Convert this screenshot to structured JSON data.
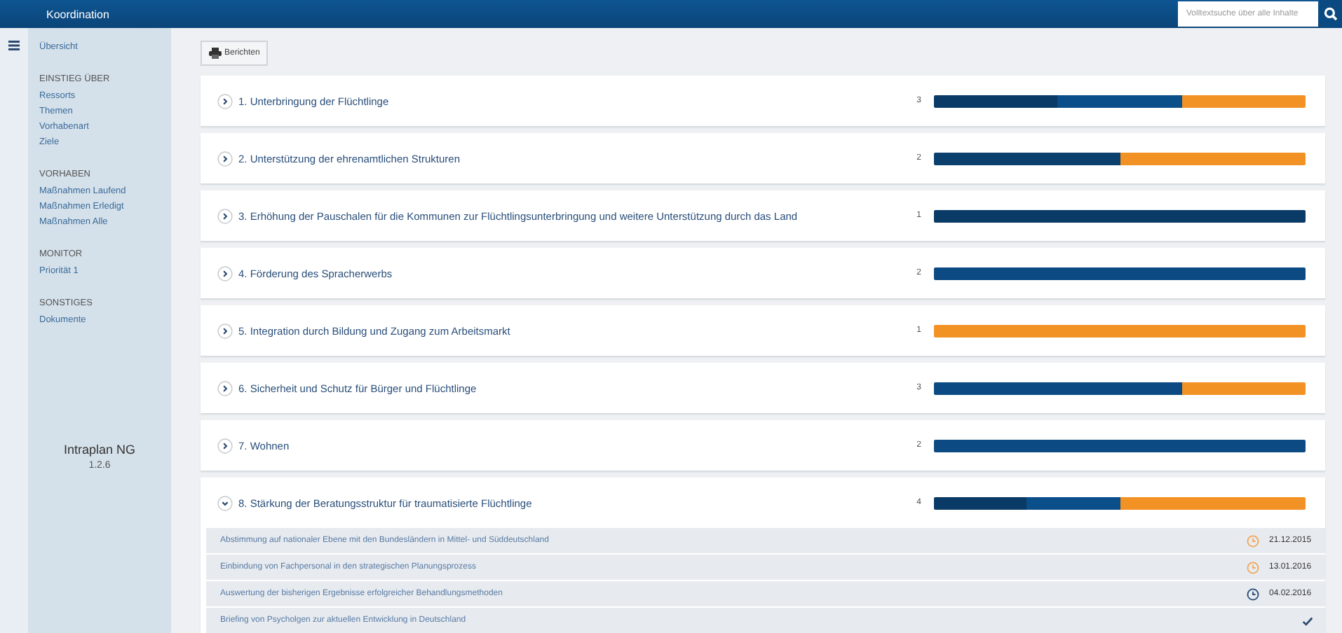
{
  "top_bar": {
    "title": "Koordination",
    "search": {
      "placeholder": "Volltextsuche über alle Inhalte"
    }
  },
  "sidebar": {
    "overview": "Übersicht",
    "sections": [
      {
        "heading": "EINSTIEG ÜBER",
        "items": [
          "Ressorts",
          "Themen",
          "Vorhabenart",
          "Ziele"
        ]
      },
      {
        "heading": "VORHABEN",
        "items": [
          "Maßnahmen Laufend",
          "Maßnahmen Erledigt",
          "Maßnahmen Alle"
        ]
      },
      {
        "heading": "MONITOR",
        "items": [
          "Priorität 1"
        ]
      },
      {
        "heading": "SONSTIGES",
        "items": [
          "Dokumente"
        ]
      }
    ],
    "app_name": "Intraplan NG",
    "version": "1.2.6"
  },
  "toolbar": {
    "report_button": "Berichten"
  },
  "goals": [
    {
      "title": "1. Unterbringung der Flüchtlinge",
      "count": "3",
      "expanded": false,
      "segments": [
        {
          "color": "#0a3a66"
        },
        {
          "color": "#0b4f8a"
        },
        {
          "color": "#f39224"
        }
      ]
    },
    {
      "title": "2. Unterstützung der ehrenamtlichen Strukturen",
      "count": "2",
      "expanded": false,
      "segments": [
        {
          "color": "#0a3f6e"
        },
        {
          "color": "#f39224"
        }
      ]
    },
    {
      "title": "3. Erhöhung der Pauschalen für die Kommunen zur Flüchtlingsunterbringung und weitere Unterstützung durch das Land",
      "count": "1",
      "expanded": false,
      "segments": [
        {
          "color": "#0a3a66"
        }
      ]
    },
    {
      "title": "4. Förderung des Spracherwerbs",
      "count": "2",
      "expanded": false,
      "segments": [
        {
          "color": "#0b4a82"
        },
        {
          "color": "#0b4a82"
        }
      ]
    },
    {
      "title": "5. Integration durch Bildung und Zugang zum Arbeitsmarkt",
      "count": "1",
      "expanded": false,
      "segments": [
        {
          "color": "#f39224"
        }
      ]
    },
    {
      "title": "6. Sicherheit und Schutz für Bürger und Flüchtlinge",
      "count": "3",
      "expanded": false,
      "segments": [
        {
          "color": "#0b4a82"
        },
        {
          "color": "#0b4a82"
        },
        {
          "color": "#f39224"
        }
      ]
    },
    {
      "title": "7. Wohnen",
      "count": "2",
      "expanded": false,
      "segments": [
        {
          "color": "#0b4a82"
        },
        {
          "color": "#0b4a82"
        }
      ]
    },
    {
      "title": "8. Stärkung der Beratungsstruktur für traumatisierte Flüchtlinge",
      "count": "4",
      "expanded": true,
      "segments": [
        {
          "color": "#0a3a66"
        },
        {
          "color": "#0b4f8a"
        },
        {
          "color": "#f39224"
        },
        {
          "color": "#f39224"
        }
      ],
      "measures": [
        {
          "text": "Abstimmung auf nationaler Ebene mit den Bundesländern in Mittel- und Süddeutschland",
          "kind": "clock",
          "color": "#f3a654",
          "date": "21.12.2015"
        },
        {
          "text": "Einbindung von Fachpersonal in den strategischen Planungsprozess",
          "kind": "clock",
          "color": "#f3a654",
          "date": "13.01.2016"
        },
        {
          "text": "Auswertung der bisherigen Ergebnisse erfolgreicher Behandlungsmethoden",
          "kind": "clock",
          "color": "#284a78",
          "date": "04.02.2016"
        },
        {
          "text": "Briefing von Psycholgen zur aktuellen Entwicklung in Deutschland",
          "kind": "done"
        }
      ]
    }
  ]
}
